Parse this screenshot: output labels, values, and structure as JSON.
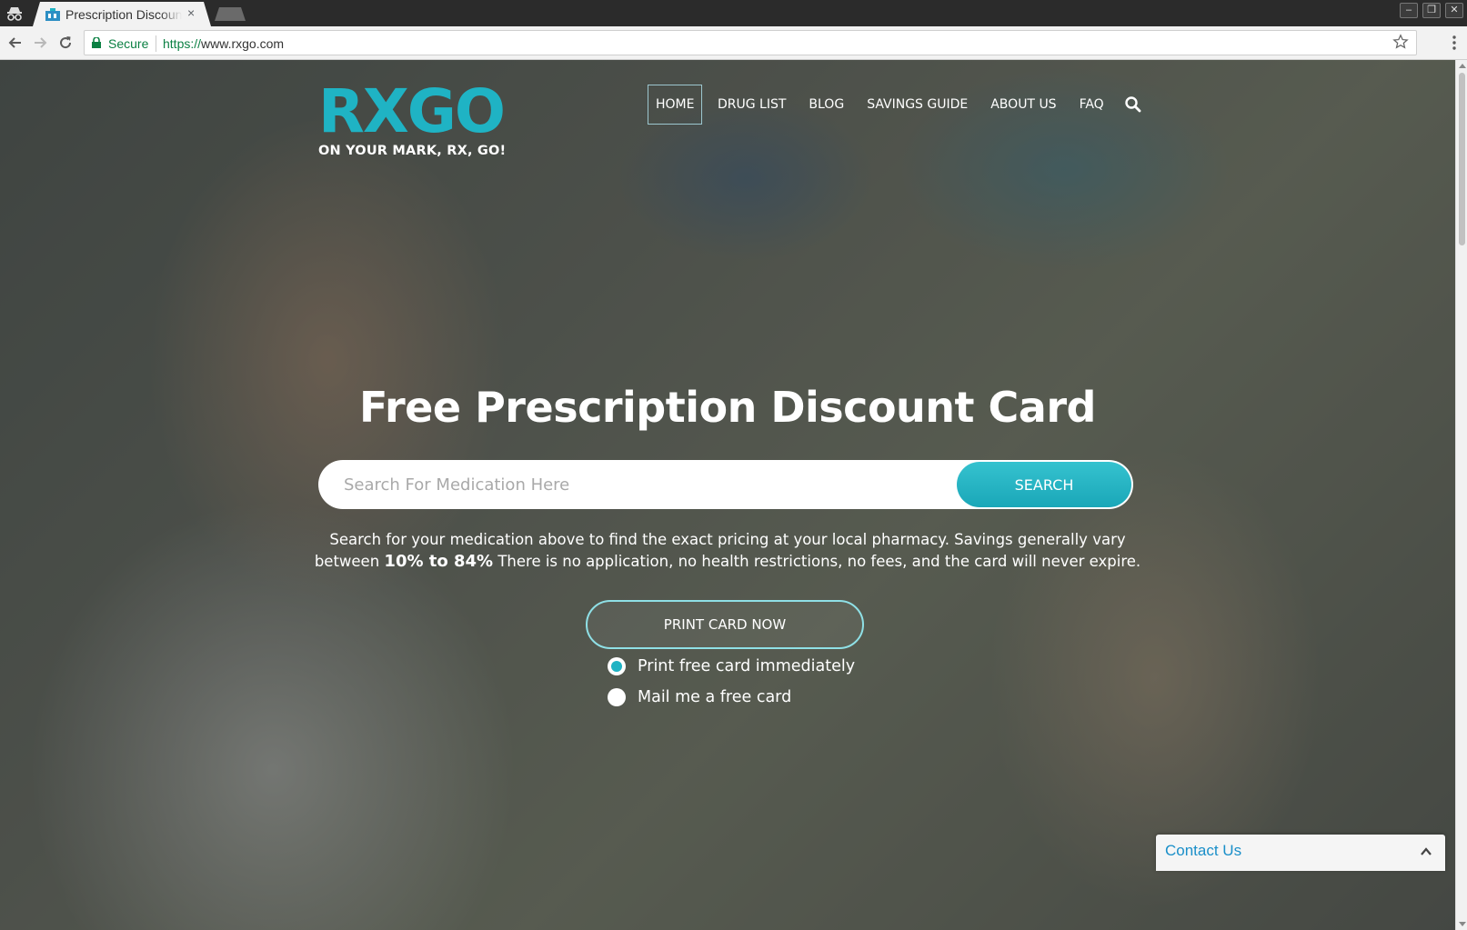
{
  "browser": {
    "tab_title": "Prescription Discount Card",
    "tab_close": "×",
    "secure_label": "Secure",
    "url_scheme": "https://",
    "url_rest": "www.rxgo.com",
    "window_controls": [
      "–",
      "❐",
      "✕"
    ]
  },
  "site": {
    "logo_text": "RXGO",
    "tagline": "ON YOUR MARK, RX, GO!",
    "brand_color": "#1fb3c4",
    "nav": {
      "items": [
        "HOME",
        "DRUG LIST",
        "BLOG",
        "SAVINGS GUIDE",
        "ABOUT US",
        "FAQ"
      ],
      "active": "HOME"
    }
  },
  "hero": {
    "headline": "Free Prescription Discount Card",
    "search_placeholder": "Search For Medication Here",
    "search_button": "SEARCH",
    "blurb_lead": "Search for your medication above to find the exact pricing at your local pharmacy. Savings generally vary between ",
    "blurb_bold": "10% to 84%",
    "blurb_tail": " There is no application, no health restrictions, no fees, and the card will never expire.",
    "print_button": "PRINT CARD NOW",
    "options": [
      {
        "label": "Print free card immediately",
        "checked": true
      },
      {
        "label": "Mail me a free card",
        "checked": false
      }
    ]
  },
  "contact_widget": {
    "label": "Contact Us"
  }
}
